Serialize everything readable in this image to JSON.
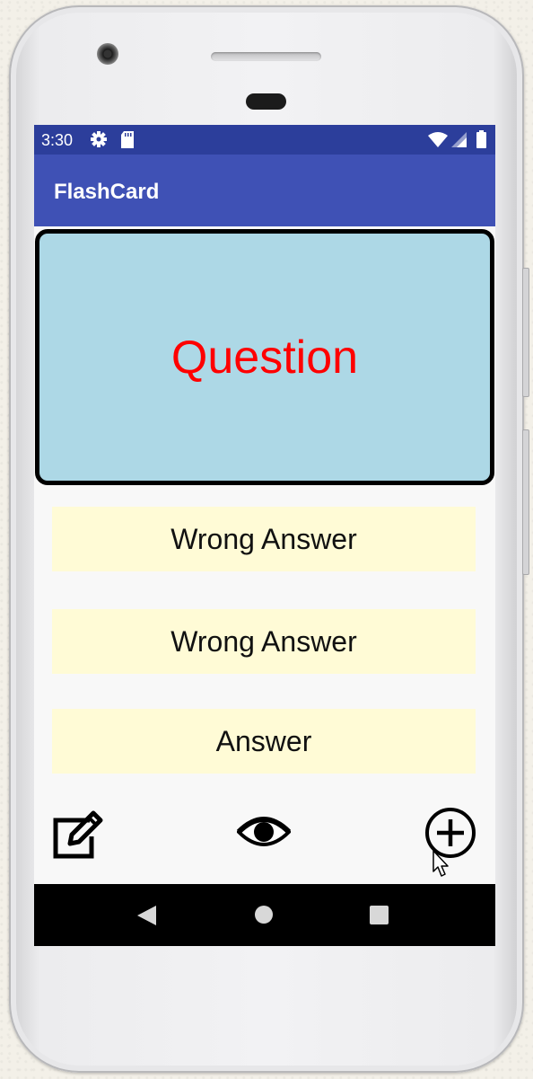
{
  "status_bar": {
    "time": "3:30",
    "icons": [
      "settings-icon",
      "sd-card-icon",
      "wifi-icon",
      "signal-icon",
      "battery-icon"
    ]
  },
  "app_bar": {
    "title": "FlashCard"
  },
  "flashcard": {
    "question": "Question",
    "background_color": "#add8e6",
    "text_color": "#ff0000"
  },
  "answers": [
    {
      "label": "Wrong Answer"
    },
    {
      "label": "Wrong Answer"
    },
    {
      "label": "Answer"
    }
  ],
  "actions": {
    "icons": [
      "edit-icon",
      "eye-icon",
      "add-circle-icon"
    ]
  },
  "navigation": {
    "icons": [
      "back-icon",
      "home-icon",
      "recents-icon"
    ]
  },
  "colors": {
    "status_bar": "#2c3e9b",
    "app_bar": "#3f51b5",
    "answer_background": "#fffbd6"
  }
}
